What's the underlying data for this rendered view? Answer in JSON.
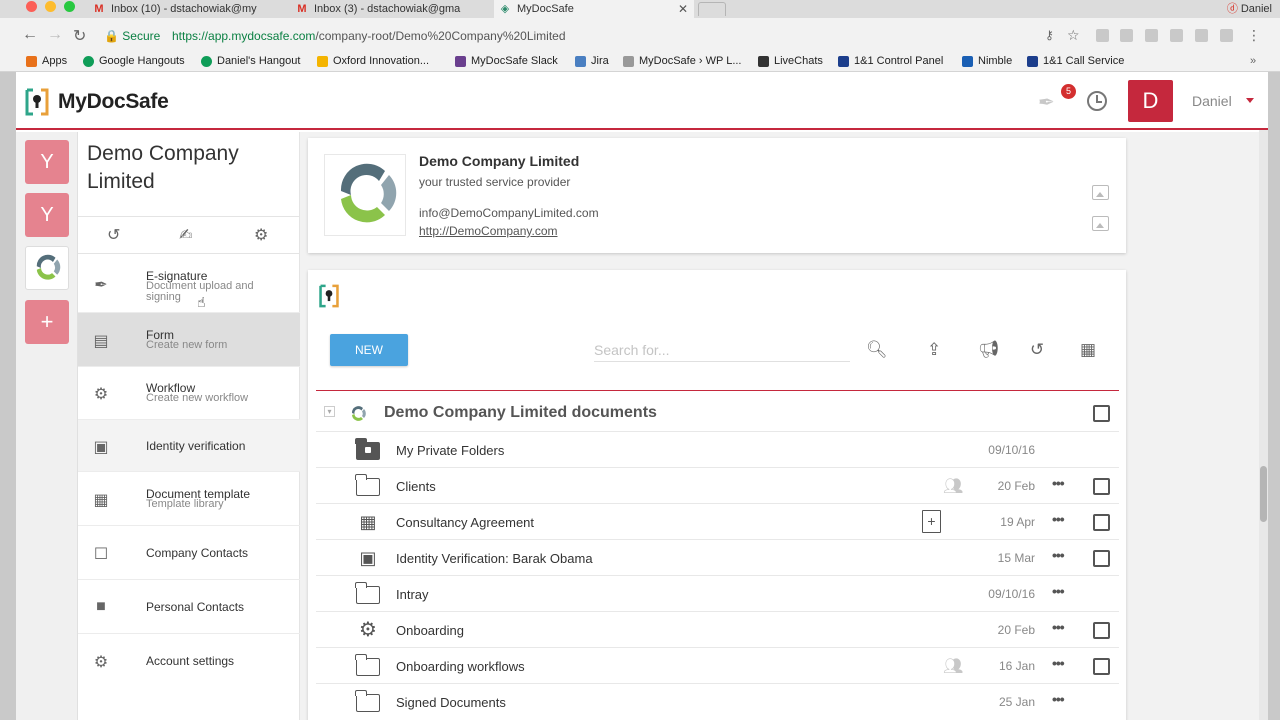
{
  "browser": {
    "tabs": [
      {
        "label": "Inbox (10) - dstachowiak@my"
      },
      {
        "label": "Inbox (3) - dstachowiak@gma"
      },
      {
        "label": "MyDocSafe"
      }
    ],
    "profile_name": "Daniel",
    "secure_label": "Secure",
    "url_host": "https://app.mydocsafe.com",
    "url_path": "/company-root/Demo%20Company%20Limited",
    "bookmarks": [
      {
        "label": "Apps",
        "color": "#e8711a"
      },
      {
        "label": "Google Hangouts",
        "color": "#0f9d58"
      },
      {
        "label": "Daniel's Hangout",
        "color": "#0f9d58"
      },
      {
        "label": "Oxford Innovation...",
        "color": "#f4b400"
      },
      {
        "label": "MyDocSafe Slack",
        "color": "#6a3f8e"
      },
      {
        "label": "Jira",
        "color": "#4a7fc1"
      },
      {
        "label": "MyDocSafe › WP L...",
        "color": "#999999"
      },
      {
        "label": "LiveChats",
        "color": "#333333"
      },
      {
        "label": "1&1 Control Panel",
        "color": "#1c3e8c"
      },
      {
        "label": "Nimble",
        "color": "#1a5fb4"
      },
      {
        "label": "1&1 Call Service",
        "color": "#1c3e8c"
      }
    ]
  },
  "app": {
    "brand": "MyDocSafe",
    "notification_count": "5",
    "avatar_letter": "D",
    "user_name": "Daniel",
    "accent_color": "#c5283d"
  },
  "rail": {
    "companies": [
      {
        "letter": "Y"
      },
      {
        "letter": "Y"
      }
    ],
    "add_label": "+"
  },
  "sidebar": {
    "company_title": "Demo Company Limited",
    "menu": [
      {
        "label": "E-signature",
        "sub": "Document upload and signing"
      },
      {
        "label": "Form",
        "sub": "Create new form"
      },
      {
        "label": "Workflow",
        "sub": "Create new workflow"
      },
      {
        "label": "Identity verification",
        "sub": ""
      },
      {
        "label": "Document template",
        "sub": "Template library"
      },
      {
        "label": "Company Contacts",
        "sub": ""
      },
      {
        "label": "Personal Contacts",
        "sub": ""
      },
      {
        "label": "Account settings",
        "sub": ""
      }
    ]
  },
  "company": {
    "name": "Demo Company Limited",
    "tagline": "your trusted service provider",
    "email": "info@DemoCompanyLimited.com",
    "website": "http://DemoCompany.com"
  },
  "docs": {
    "new_label": "NEW",
    "search_placeholder": "Search for...",
    "group_title": "Demo Company Limited documents",
    "rows": [
      {
        "name": "My Private Folders",
        "date": "09/10/16",
        "icon": "private-folder-icon"
      },
      {
        "name": "Clients",
        "date": "20 Feb",
        "icon": "folder-icon"
      },
      {
        "name": "Consultancy Agreement",
        "date": "19 Apr",
        "icon": "form-document-icon"
      },
      {
        "name": "Identity Verification: Barak Obama",
        "date": "15 Mar",
        "icon": "id-card-icon"
      },
      {
        "name": "Intray",
        "date": "09/10/16",
        "icon": "folder-icon"
      },
      {
        "name": "Onboarding",
        "date": "20 Feb",
        "icon": "workflow-gears-icon"
      },
      {
        "name": "Onboarding workflows",
        "date": "16 Jan",
        "icon": "folder-icon"
      },
      {
        "name": "Signed Documents",
        "date": "25 Jan",
        "icon": "folder-icon"
      }
    ]
  }
}
